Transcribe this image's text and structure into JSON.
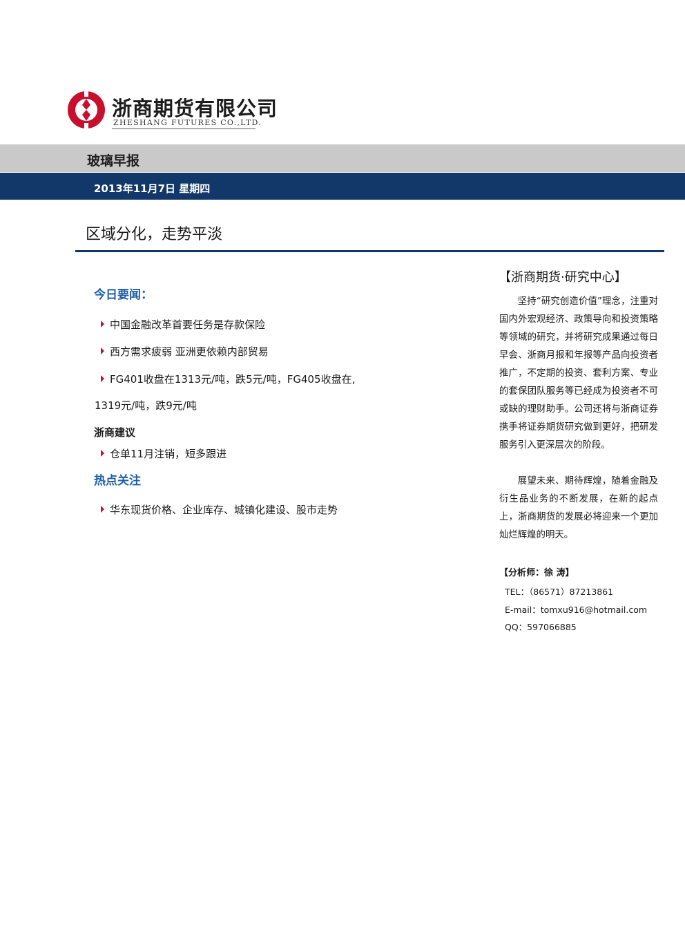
{
  "company": {
    "name_cn": "浙商期货有限公司",
    "name_en": "ZHESHANG FUTURES CO.,LTD.",
    "brand_color": "#c8102e"
  },
  "report": {
    "type": "玻璃早报",
    "date": "2013年11月7日 星期四",
    "headline": "区域分化，走势平淡"
  },
  "sections": {
    "news": {
      "title": "今日要闻：",
      "items": [
        "中国金融改革首要任务是存款保险",
        "西方需求疲弱 亚洲更依赖内部贸易",
        "FG401收盘在1313元/吨，跌5元/吨，FG405收盘在,"
      ],
      "continuation": "1319元/吨，跌9元/吨"
    },
    "advice": {
      "title": "浙商建议",
      "items": [
        "仓单11月注销，短多跟进"
      ]
    },
    "focus": {
      "title": "热点关注",
      "items": [
        "华东现货价格、企业库存、城镇化建设、股市走势"
      ]
    }
  },
  "sidebar": {
    "title": "【浙商期货·研究中心】",
    "para1": "坚持“研究创造价值”理念，注重对国内外宏观经济、政策导向和投资策略等领域的研究，并将研究成果通过每日早会、浙商月报和年报等产品向投资者推广，不定期的投资、套利方案、专业的套保团队服务等已经成为投资者不可或缺的理财助手。公司还将与浙商证券携手将证券期货研究做到更好，把研发服务引入更深层次的阶段。",
    "para2": "展望未来、期待辉煌，随着金融及衍生品业务的不断发展，在新的起点上，浙商期货的发展必将迎来一个更加灿烂辉煌的明天。",
    "analyst": "【分析师：徐 涛】",
    "tel": "TEL：（86571）87213861",
    "email": "E-mail：tomxu916@hotmail.com",
    "qq": "QQ：597066885"
  },
  "colors": {
    "navy": "#123869",
    "gray_band": "#c9c9c9",
    "section_blue": "#1f5fa6",
    "bullet_red": "#c8102e"
  }
}
